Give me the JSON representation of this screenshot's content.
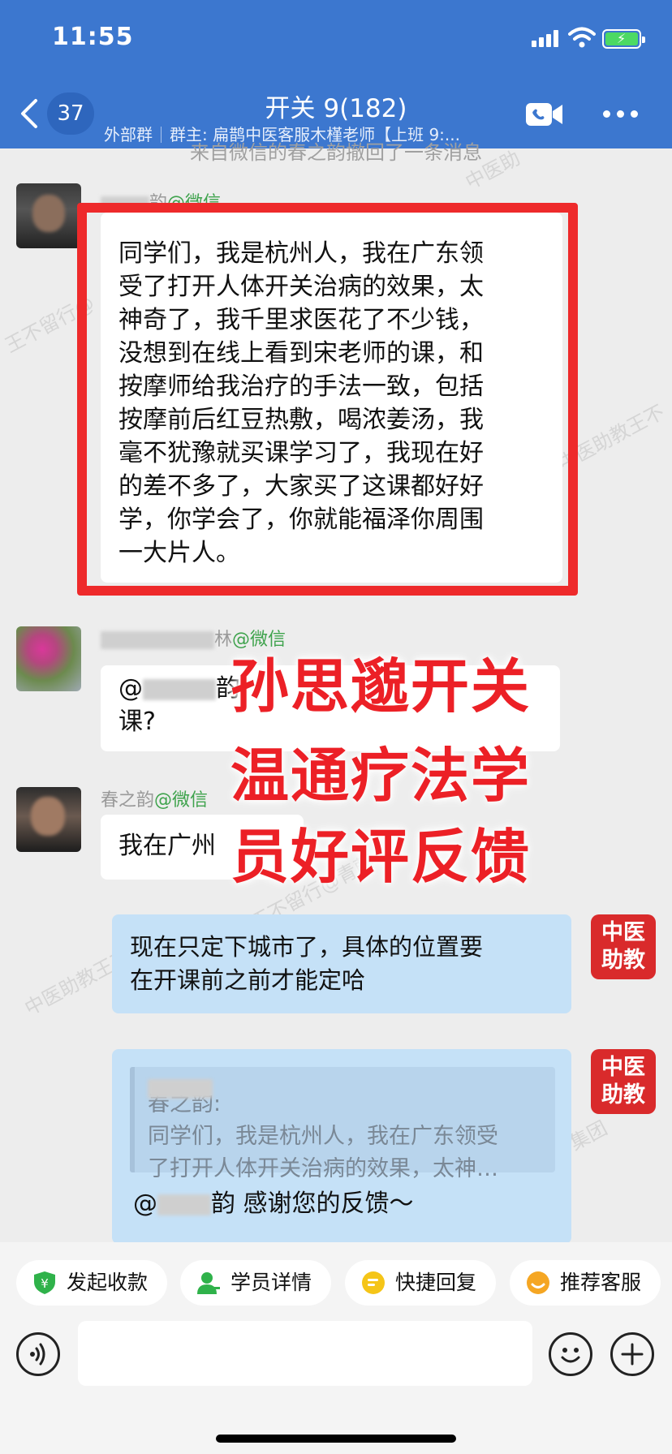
{
  "status": {
    "time": "11:55"
  },
  "header": {
    "unread_count": "37",
    "title": "开关 9(182)",
    "group_type": "外部群",
    "group_owner": "群主: 扁鹊中医客服木槿老师【上班 9:..."
  },
  "chat": {
    "system_note": "来自微信的春之韵撤回了一条消息",
    "messages": [
      {
        "sender_visible": "韵",
        "source": "@微信",
        "text": "同学们，我是杭州人，我在广东领受了打开人体开关治病的效果，太神奇了，我千里求医花了不少钱，没想到在线上看到宋老师的课，和按摩师给我治疗的手法一致，包括按摩前后红豆热敷，喝浓姜汤，我毫不犹豫就买课学习了，我现在好的差不多了，大家买了这课都好好学，你学会了，你就能福泽你周围一大片人。",
        "lines": [
          "同学们，我是杭州人，我在广东领",
          "受了打开人体开关治病的效果，太",
          "神奇了，我千里求医花了不少钱，",
          "没想到在线上看到宋老师的课，和",
          "按摩师给我治疗的手法一致，包括",
          "按摩前后红豆热敷，喝浓姜汤，我",
          "毫不犹豫就买课学习了，我现在好",
          "的差不多了，大家买了这课都好好",
          "学，你学会了，你就能福泽你周围",
          "一大片人。"
        ]
      },
      {
        "sender_visible": "林",
        "source": "@微信",
        "line1_prefix": "@",
        "line1_suffix": "韵",
        "line2": "课?"
      },
      {
        "sender_visible": "春之韵",
        "source": "@微信",
        "text": "我在广州"
      },
      {
        "text_lines": [
          "现在只定下城市了，具体的位置要",
          "在开课前之前才能定哈"
        ],
        "tag": [
          "中医",
          "助教"
        ]
      },
      {
        "quote_name": "春之韵:",
        "quote_lines": [
          "同学们，我是杭州人，我在广东领受",
          "了打开人体开关治病的效果，太神…"
        ],
        "reply_prefix": "@",
        "reply_suffix": "韵 感谢您的反馈～",
        "tag": [
          "中医",
          "助教"
        ]
      }
    ]
  },
  "overlay": {
    "lines": [
      "孙思邈开关",
      "温通疗法学",
      "员好评反馈"
    ]
  },
  "quick_actions": [
    {
      "label": "发起收款",
      "color": "#2fb24a"
    },
    {
      "label": "学员详情",
      "color": "#2fb24a"
    },
    {
      "label": "快捷回复",
      "color": "#f5c518"
    },
    {
      "label": "推荐客服",
      "color": "#f5a623"
    }
  ],
  "watermarks": [
    "王不留行@",
    "中医助教王不",
    "王不留行@青藤",
    "中医助教王不留行",
    "中医助",
    "集团"
  ]
}
